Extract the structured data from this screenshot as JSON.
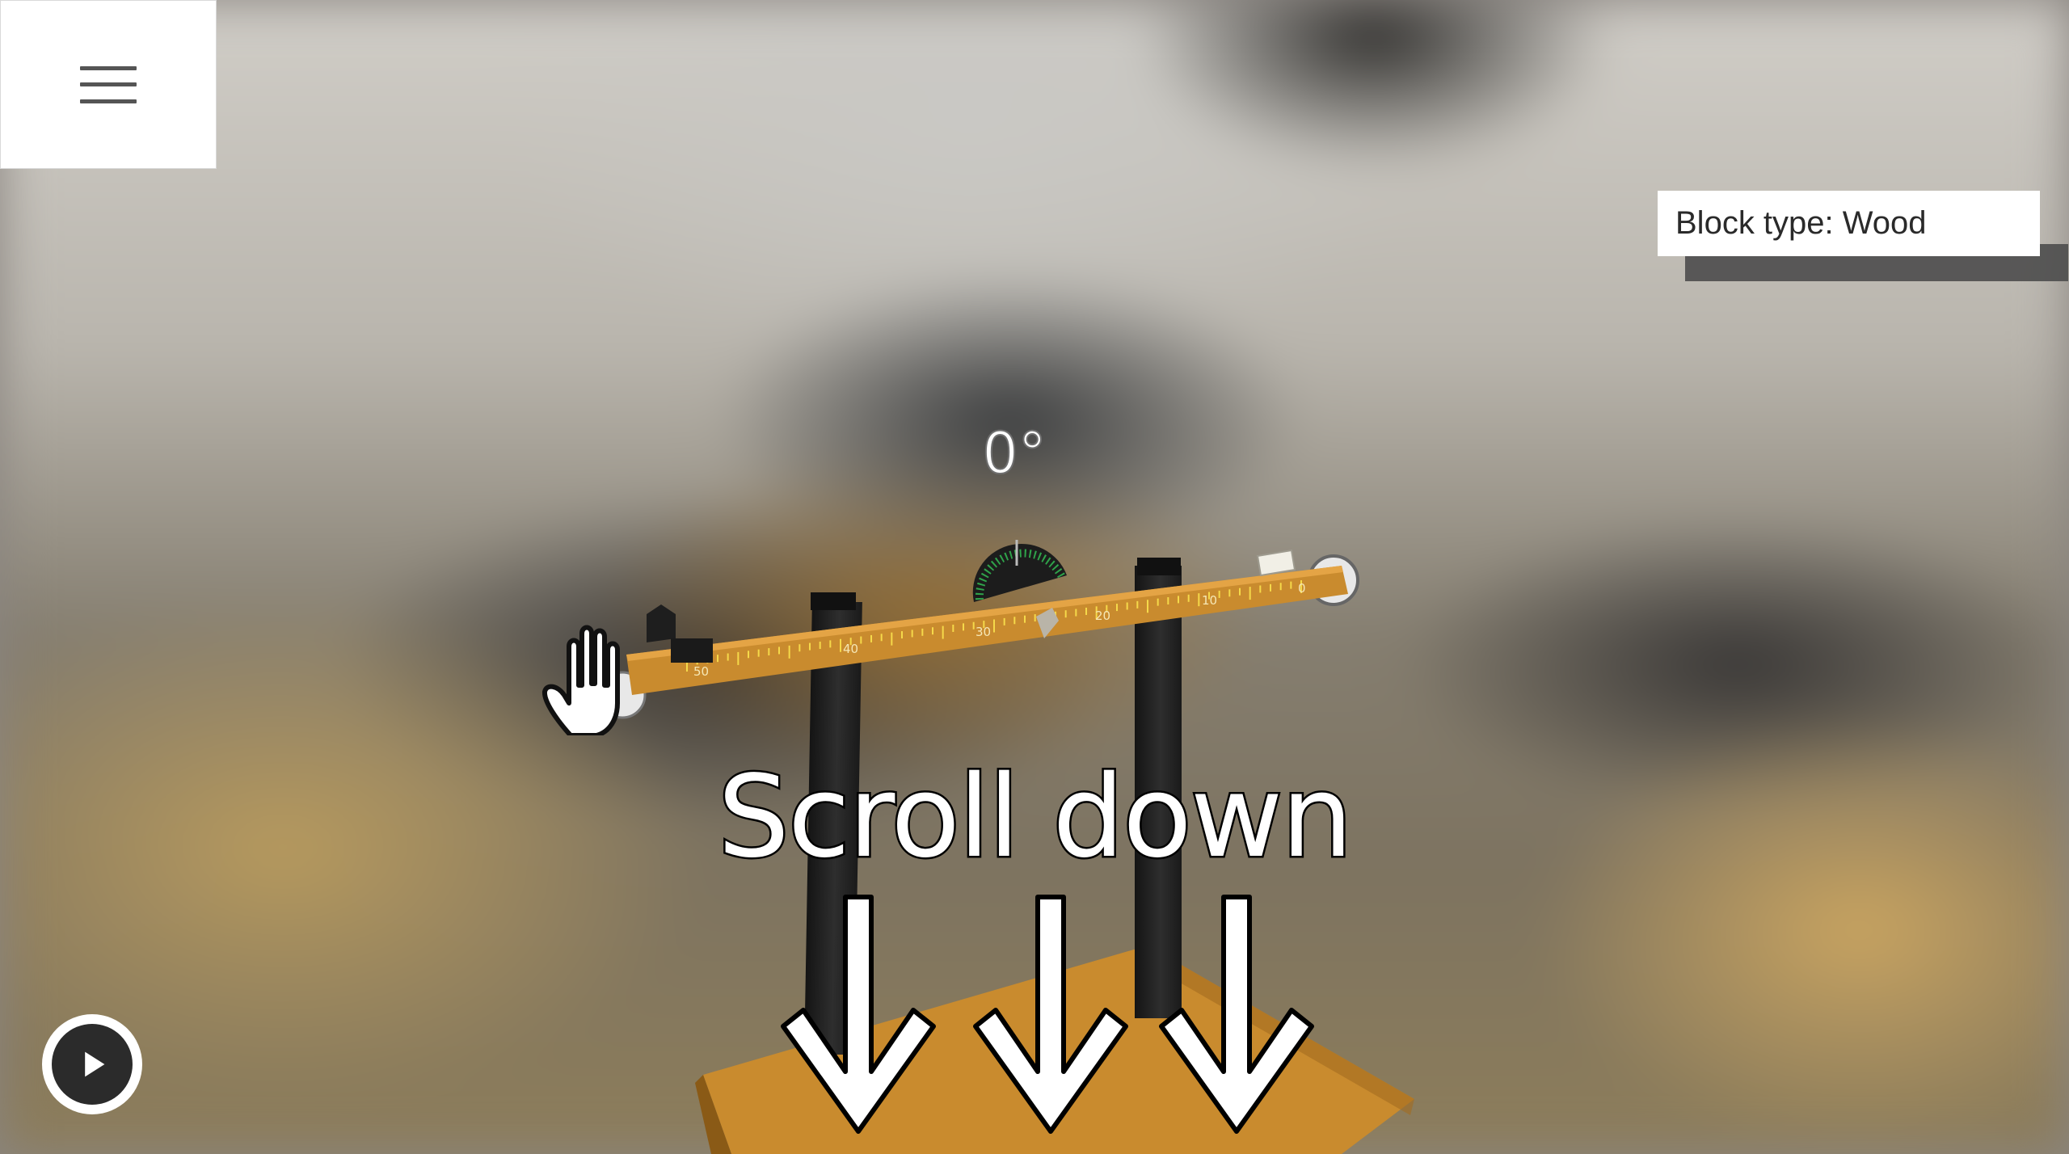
{
  "menu": {
    "icon": "hamburger-menu-icon"
  },
  "block_info": {
    "label": "Block type: Wood"
  },
  "angle": {
    "value": "0°"
  },
  "beam": {
    "ruler_labels": [
      "50",
      "40",
      "30",
      "20",
      "10",
      "0"
    ]
  },
  "hint": {
    "text": "Scroll down",
    "arrow_count": 3,
    "arrow_icon": "down-arrow-icon"
  },
  "controls": {
    "play_icon": "play-icon",
    "cursor_icon": "grab-hand-icon"
  },
  "colors": {
    "beam": "#c98b2e",
    "ticks": "#f5d94a",
    "protractor": "#1f8a3a",
    "text_stroke": "#000000"
  }
}
